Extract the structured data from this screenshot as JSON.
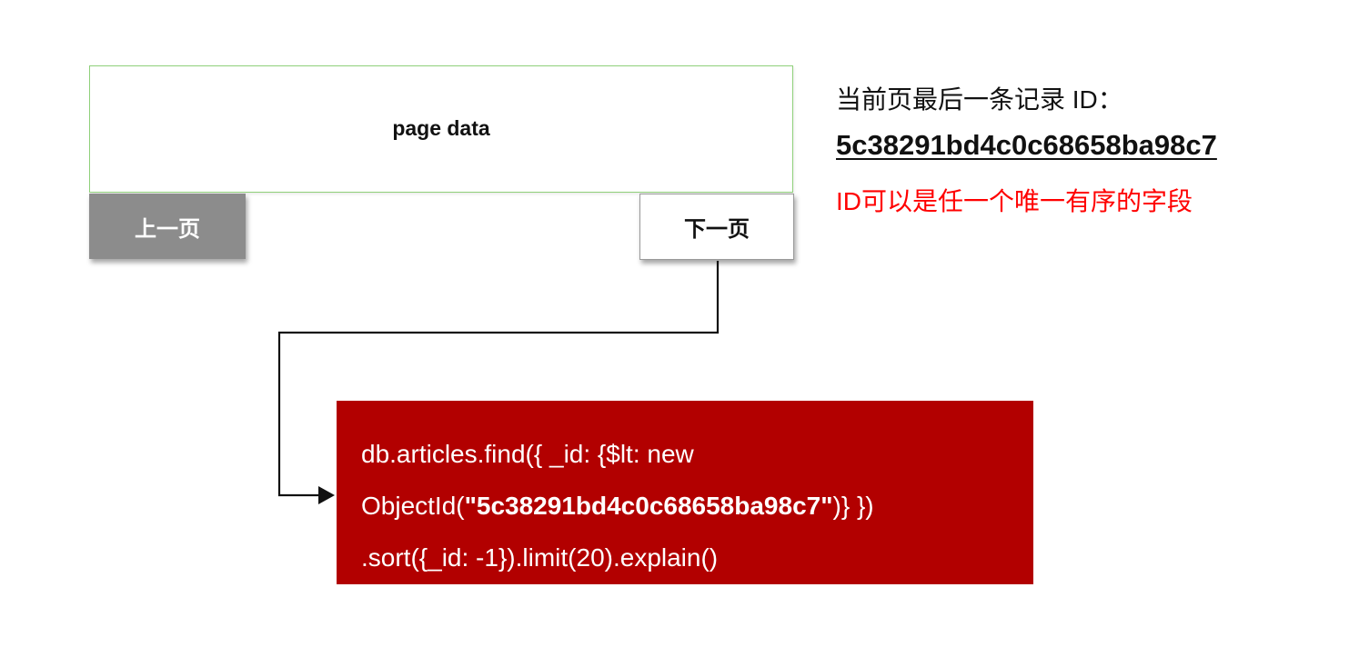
{
  "page_box": {
    "label": "page data"
  },
  "buttons": {
    "prev": "上一页",
    "next": "下一页"
  },
  "info": {
    "title": "当前页最后一条记录 ID：",
    "last_id": "5c38291bd4c0c68658ba98c7",
    "note": "ID可以是任一个唯一有序的字段"
  },
  "query": {
    "line1": "db.articles.find({ _id: {$lt: new",
    "line2_prefix": "ObjectId(",
    "line2_quote_open": "\"",
    "line2_id": "5c38291bd4c0c68658ba98c7",
    "line2_quote_close": "\"",
    "line2_suffix": ")} })",
    "line3": ".sort({_id: -1}).limit(20).explain()"
  },
  "colors": {
    "query_background": "#b20000",
    "note_text": "#ff0000",
    "prev_button": "#8c8c8c",
    "page_box_border": "#8fd07a"
  }
}
